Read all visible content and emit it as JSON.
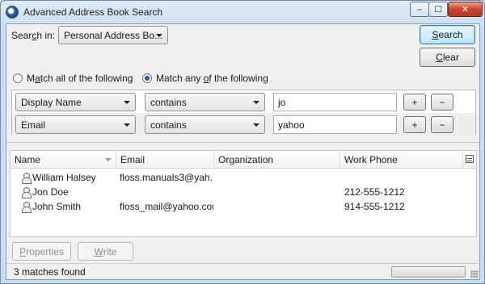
{
  "window": {
    "title": "Advanced Address Book Search",
    "minimize_glyph": "–",
    "maximize_glyph": "☐",
    "close_glyph": "✕"
  },
  "search": {
    "in_label_pre": "Sear",
    "in_label_u": "c",
    "in_label_post": "h in:",
    "address_book": "Personal Address Bo...",
    "search_u": "S",
    "search_rest": "earch",
    "clear_u": "C",
    "clear_rest": "lear"
  },
  "match": {
    "all_pre": "M",
    "all_u": "a",
    "all_post": "tch all of the following",
    "any_pre": "Match any ",
    "any_u": "o",
    "any_post": "f the following",
    "selected": "any"
  },
  "criteria": [
    {
      "field": "Display Name",
      "operator": "contains",
      "value": "jo",
      "plus": "+",
      "minus": "−"
    },
    {
      "field": "Email",
      "operator": "contains",
      "value": "yahoo",
      "plus": "+",
      "minus": "−"
    }
  ],
  "results": {
    "columns": [
      "Name",
      "Email",
      "Organization",
      "Work Phone"
    ],
    "rows": [
      {
        "name": "William Halsey",
        "email": "floss.manuals3@yah...",
        "organization": "",
        "work_phone": ""
      },
      {
        "name": "Jon Doe",
        "email": "",
        "organization": "",
        "work_phone": "212-555-1212"
      },
      {
        "name": "John Smith",
        "email": "floss_mail@yahoo.com",
        "organization": "",
        "work_phone": "914-555-1212"
      }
    ]
  },
  "actions": {
    "properties_u": "P",
    "properties_rest": "roperties",
    "write_u": "W",
    "write_rest": "rite"
  },
  "status": {
    "text": "3 matches found"
  }
}
